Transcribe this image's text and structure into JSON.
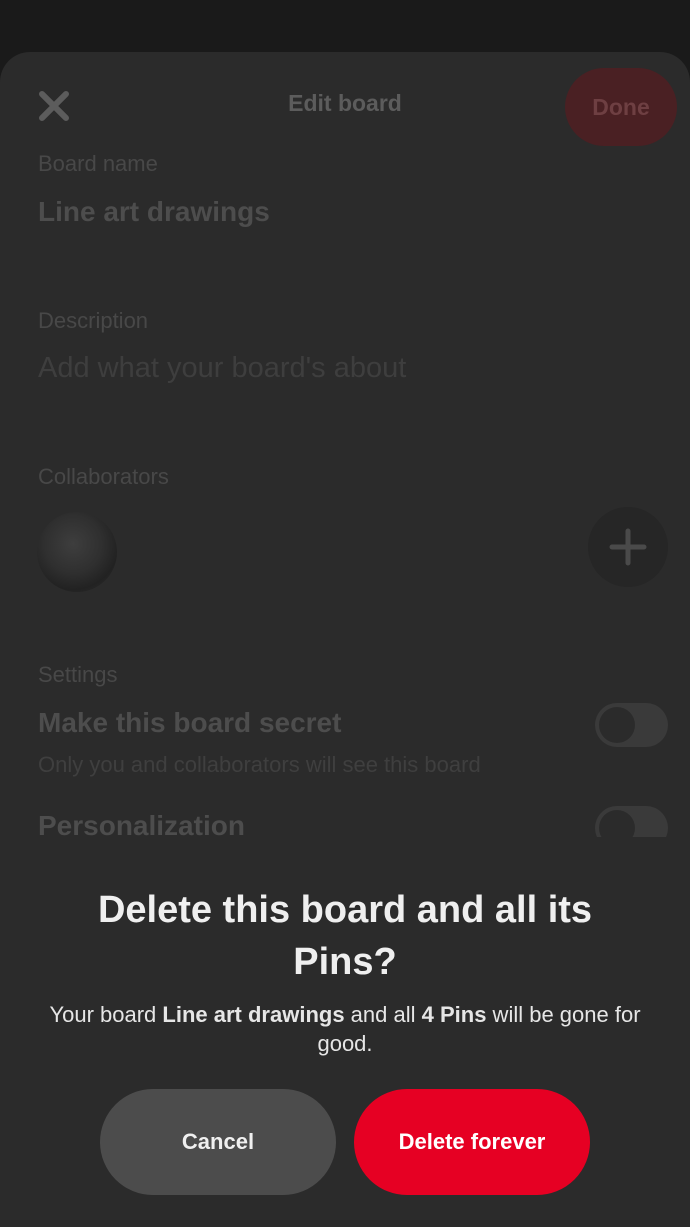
{
  "header": {
    "title": "Edit board",
    "done_label": "Done"
  },
  "form": {
    "board_name_label": "Board name",
    "board_name_value": "Line art drawings",
    "description_label": "Description",
    "description_placeholder": "Add what your board's about",
    "collaborators_label": "Collaborators",
    "settings_label": "Settings",
    "secret_title": "Make this board secret",
    "secret_desc": "Only you and collaborators will see this board",
    "personalization_title": "Personalization"
  },
  "dialog": {
    "title": "Delete this board and all its Pins?",
    "message_prefix": "Your board ",
    "board_name": "Line art drawings",
    "message_middle": " and all ",
    "pin_count": "4 Pins",
    "message_suffix": " will be gone for good.",
    "cancel_label": "Cancel",
    "delete_label": "Delete forever"
  },
  "colors": {
    "accent": "#e60023",
    "background": "#2b2b2b"
  },
  "icons": {
    "close": "close-icon",
    "add": "plus-icon"
  }
}
